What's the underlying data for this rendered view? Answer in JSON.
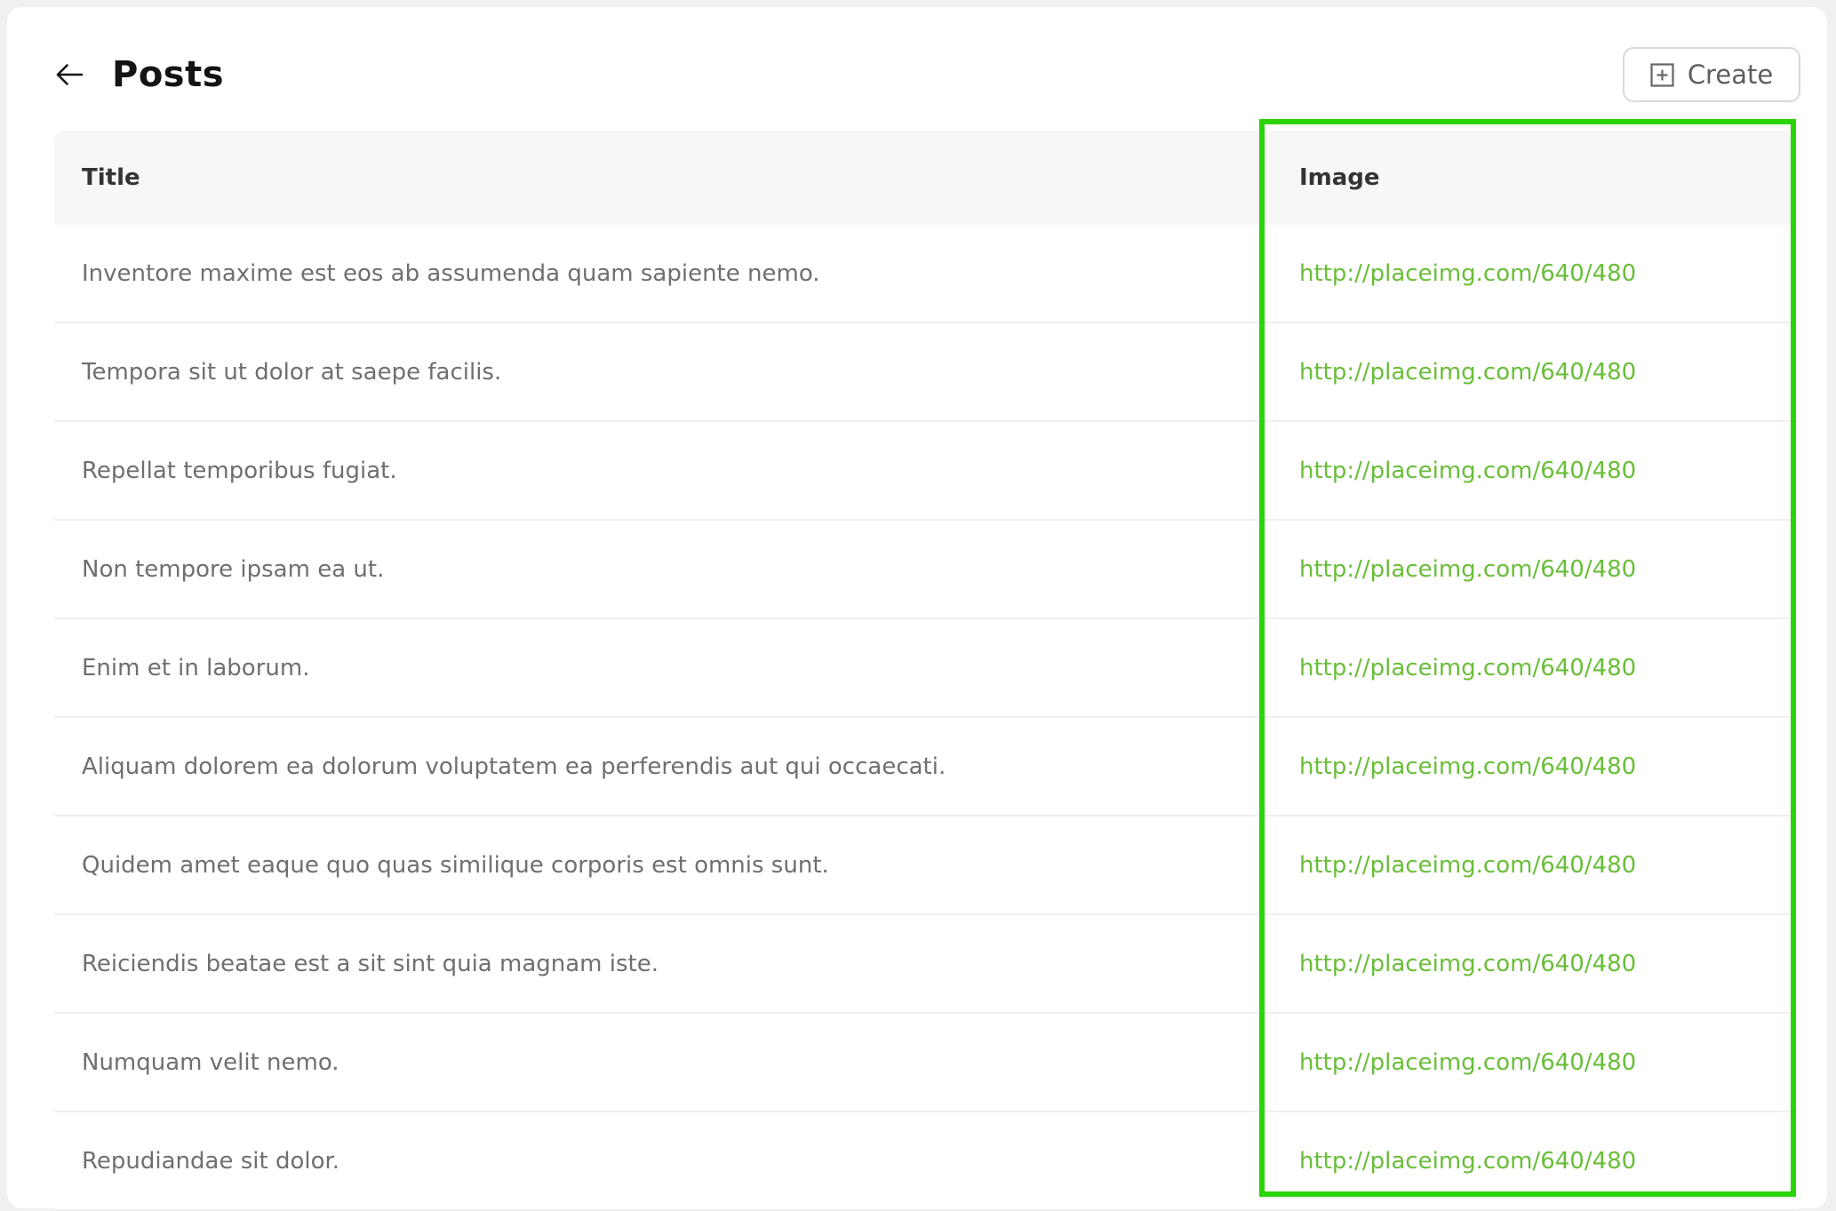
{
  "header": {
    "title": "Posts"
  },
  "toolbar": {
    "create_label": "Create"
  },
  "table": {
    "columns": {
      "title": "Title",
      "image": "Image"
    },
    "rows": [
      {
        "title": "Inventore maxime est eos ab assumenda quam sapiente nemo.",
        "image": "http://placeimg.com/640/480"
      },
      {
        "title": "Tempora sit ut dolor at saepe facilis.",
        "image": "http://placeimg.com/640/480"
      },
      {
        "title": "Repellat temporibus fugiat.",
        "image": "http://placeimg.com/640/480"
      },
      {
        "title": "Non tempore ipsam ea ut.",
        "image": "http://placeimg.com/640/480"
      },
      {
        "title": "Enim et in laborum.",
        "image": "http://placeimg.com/640/480"
      },
      {
        "title": "Aliquam dolorem ea dolorum voluptatem ea perferendis aut qui occaecati.",
        "image": "http://placeimg.com/640/480"
      },
      {
        "title": "Quidem amet eaque quo quas similique corporis est omnis sunt.",
        "image": "http://placeimg.com/640/480"
      },
      {
        "title": "Reiciendis beatae est a sit sint quia magnam iste.",
        "image": "http://placeimg.com/640/480"
      },
      {
        "title": "Numquam velit nemo.",
        "image": "http://placeimg.com/640/480"
      },
      {
        "title": "Repudiandae sit dolor.",
        "image": "http://placeimg.com/640/480"
      }
    ]
  },
  "highlight": {
    "target_column": "Image",
    "border_color": "#2BD30A"
  },
  "colors": {
    "link_green": "#69BE39",
    "highlight_green": "#2BD30A",
    "header_bg": "#F7F7F7",
    "page_bg": "#F0F0EE"
  }
}
